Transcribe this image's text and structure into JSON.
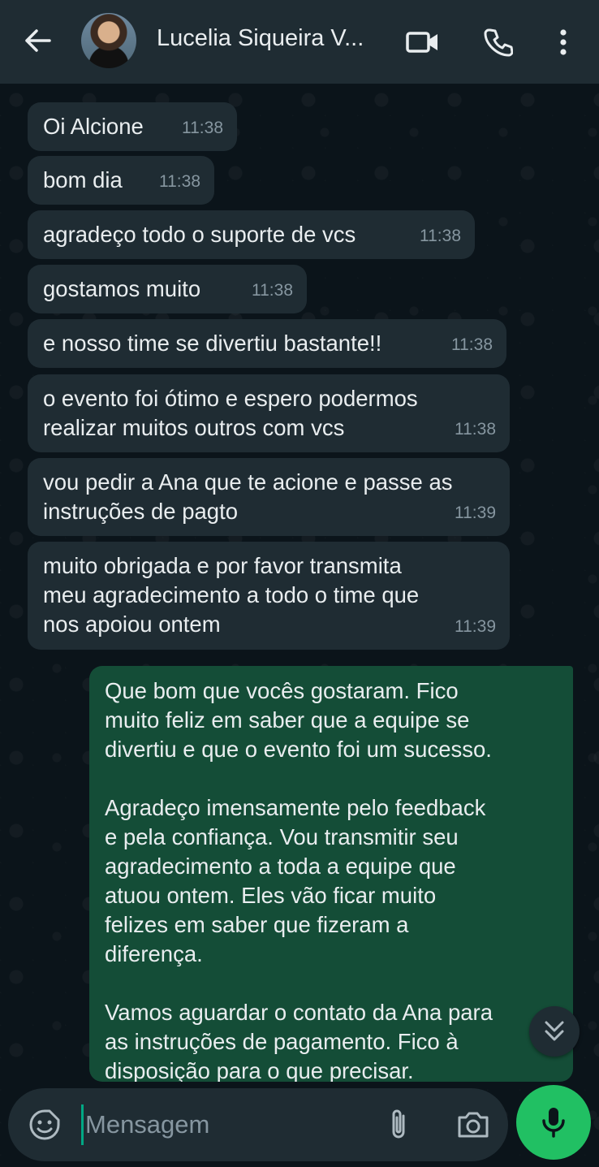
{
  "header": {
    "contact_name": "Lucelia Siqueira V...",
    "icons": {
      "back": "arrow-left-icon",
      "video": "video-call-icon",
      "phone": "phone-call-icon",
      "menu": "more-vert-icon"
    }
  },
  "messages": [
    {
      "direction": "in",
      "text": "Oi Alcione",
      "time": "11:38"
    },
    {
      "direction": "in",
      "text": "bom dia",
      "time": "11:38"
    },
    {
      "direction": "in",
      "text": "agradeço todo o suporte de vcs",
      "time": "11:38"
    },
    {
      "direction": "in",
      "text": "gostamos muito",
      "time": "11:38"
    },
    {
      "direction": "in",
      "text": "e nosso time se divertiu bastante!!",
      "time": "11:38"
    },
    {
      "direction": "in",
      "text": "o evento foi ótimo e espero podermos\nrealizar muitos outros com vcs",
      "time": "11:38"
    },
    {
      "direction": "in",
      "text": "vou pedir a Ana que te acione e passe as\ninstruções de pagto",
      "time": "11:39"
    },
    {
      "direction": "in",
      "text": "muito obrigada e por favor transmita\nmeu agradecimento a todo o time que\nnos apoiou ontem",
      "time": "11:39"
    },
    {
      "direction": "out",
      "text": "Que bom que vocês gostaram. Fico\nmuito feliz em saber que a equipe se\ndivertiu e que o evento foi um sucesso.\n\nAgradeço imensamente pelo feedback\ne pela confiança. Vou transmitir seu\nagradecimento a toda a equipe que\natuou ontem. Eles vão ficar muito\nfelizes em saber que fizeram a\ndiferença.\n\nVamos aguardar o contato da Ana para\nas instruções de pagamento. Fico à\ndisposição para o que precisar."
    }
  ],
  "composer": {
    "placeholder": "Mensagem",
    "icons": {
      "emoji": "sticker-emoji-icon",
      "attach": "paperclip-icon",
      "camera": "camera-icon",
      "mic": "microphone-icon",
      "scroll": "double-chevron-down-icon"
    }
  },
  "colors": {
    "background": "#0b141a",
    "header": "#1f2c33",
    "incoming_bubble": "#1f2c33",
    "outgoing_bubble": "#144d37",
    "accent": "#21c063"
  }
}
